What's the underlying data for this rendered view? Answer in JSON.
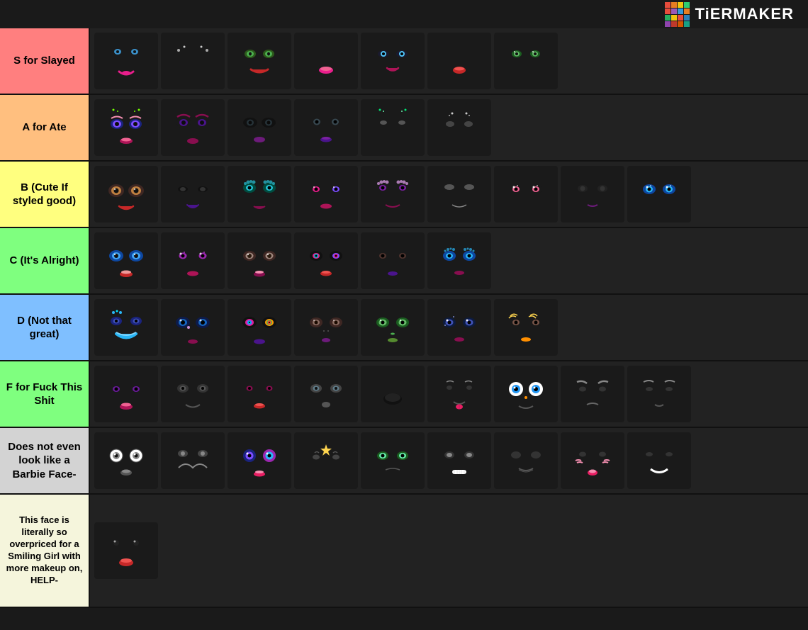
{
  "header": {
    "logo_text": "TiERMAKER",
    "logo_colors": [
      "#e74c3c",
      "#e67e22",
      "#f1c40f",
      "#2ecc71",
      "#3498db",
      "#9b59b6",
      "#e74c3c",
      "#f39c12",
      "#27ae60",
      "#2980b9",
      "#8e44ad",
      "#c0392b",
      "#d35400",
      "#16a085",
      "#2c3e50",
      "#7f8c8d"
    ]
  },
  "tiers": [
    {
      "id": "s",
      "label": "S for Slayed",
      "color": "#ff7f7f",
      "faces": [
        {
          "id": "s1",
          "desc": "pink eyes blue accent"
        },
        {
          "id": "s2",
          "desc": "dark sparkle eyes"
        },
        {
          "id": "s3",
          "desc": "green eyes glam"
        },
        {
          "id": "s4",
          "desc": "pink lips red"
        },
        {
          "id": "s5",
          "desc": "dark eyes bold"
        },
        {
          "id": "s6",
          "desc": "red lips"
        },
        {
          "id": "s7",
          "desc": "green shimmer eyes"
        }
      ]
    },
    {
      "id": "a",
      "label": "A for Ate",
      "color": "#ffbf7f",
      "faces": [
        {
          "id": "a1",
          "desc": "sparkle brown eyes"
        },
        {
          "id": "a2",
          "desc": "glamour dark eyes"
        },
        {
          "id": "a3",
          "desc": "bold dark eyes"
        },
        {
          "id": "a4",
          "desc": "dark glam eyes"
        },
        {
          "id": "a5",
          "desc": "green sparkle dots"
        },
        {
          "id": "a6",
          "desc": "subtle sparkle"
        }
      ]
    },
    {
      "id": "b",
      "label": "B (Cute If styled good)",
      "color": "#ffff7f",
      "faces": [
        {
          "id": "b1",
          "desc": "warm brown eyes"
        },
        {
          "id": "b2",
          "desc": "dark smile eyes"
        },
        {
          "id": "b3",
          "desc": "teal fluffy lashes"
        },
        {
          "id": "b4",
          "desc": "sparkle glam"
        },
        {
          "id": "b5",
          "desc": "purple fluffy lashes"
        },
        {
          "id": "b6",
          "desc": "subtle face"
        },
        {
          "id": "b7",
          "desc": "pink sparkle eyes"
        },
        {
          "id": "b8",
          "desc": "dark smirk"
        },
        {
          "id": "b9",
          "desc": "blue sparkle eyes"
        }
      ]
    },
    {
      "id": "c",
      "label": "C (It's Alright)",
      "color": "#7fff7f",
      "faces": [
        {
          "id": "c1",
          "desc": "blue eyes pink lips"
        },
        {
          "id": "c2",
          "desc": "purple sparkle eyes"
        },
        {
          "id": "c3",
          "desc": "brown warm eyes"
        },
        {
          "id": "c4",
          "desc": "dark glam multicolor"
        },
        {
          "id": "c5",
          "desc": "dark brown eyes"
        },
        {
          "id": "c6",
          "desc": "blue sparkle lash"
        }
      ]
    },
    {
      "id": "d",
      "label": "D (Not that great)",
      "color": "#7fbfff",
      "faces": [
        {
          "id": "d1",
          "desc": "blue jewel eyes"
        },
        {
          "id": "d2",
          "desc": "dark blue eyes"
        },
        {
          "id": "d3",
          "desc": "rainbow glitter eyes"
        },
        {
          "id": "d4",
          "desc": "brown warm face"
        },
        {
          "id": "d5",
          "desc": "green eyes dark"
        },
        {
          "id": "d6",
          "desc": "dark crying sparkle"
        },
        {
          "id": "d7",
          "desc": "golden lash eyes"
        }
      ]
    },
    {
      "id": "f",
      "label": "F for Fuck This Shit",
      "color": "#7fff7f",
      "faces": [
        {
          "id": "f1",
          "desc": "purple eyes dark"
        },
        {
          "id": "f2",
          "desc": "brown plain eyes"
        },
        {
          "id": "f3",
          "desc": "pink dark eyes"
        },
        {
          "id": "f4",
          "desc": "grey face"
        },
        {
          "id": "f5",
          "desc": "black blob mouth"
        },
        {
          "id": "f6",
          "desc": "tongue out"
        },
        {
          "id": "f7",
          "desc": "blue cartoon eyes"
        },
        {
          "id": "f8",
          "desc": "angry brows"
        },
        {
          "id": "f9",
          "desc": "smirk brows"
        }
      ]
    },
    {
      "id": "dnb",
      "label": "Does not even look like a Barbie Face-",
      "color": "#d3d3d3",
      "faces": [
        {
          "id": "dnb1",
          "desc": "round white eyes"
        },
        {
          "id": "dnb2",
          "desc": "cartoon smile"
        },
        {
          "id": "dnb3",
          "desc": "galaxy sparkle"
        },
        {
          "id": "dnb4",
          "desc": "star accent"
        },
        {
          "id": "dnb5",
          "desc": "green alien eyes"
        },
        {
          "id": "dnb6",
          "desc": "white teeth"
        },
        {
          "id": "dnb7",
          "desc": "smug face"
        },
        {
          "id": "dnb8",
          "desc": "pink blush marks"
        },
        {
          "id": "dnb9",
          "desc": "white smile"
        }
      ]
    },
    {
      "id": "last",
      "label": "This face is literally so overpriced for a Smiling Girl with more makeup on, HELP-",
      "color": "#f5f5dc",
      "faces": [
        {
          "id": "l1",
          "desc": "simple eyes red lips"
        }
      ]
    }
  ]
}
